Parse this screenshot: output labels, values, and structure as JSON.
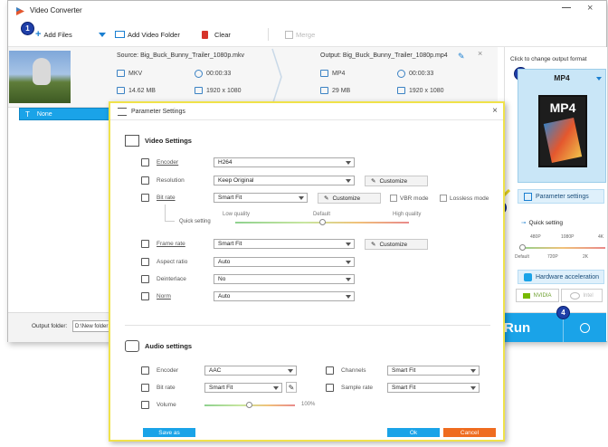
{
  "app": {
    "title": "Video Converter"
  },
  "toolbar": {
    "add_files": "Add Files",
    "add_video_folder": "Add Video Folder",
    "clear": "Clear",
    "merge": "Merge"
  },
  "callouts": [
    "1",
    "2",
    "3",
    "4"
  ],
  "file": {
    "source": "Source: Big_Buck_Bunny_Trailer_1080p.mkv",
    "output": "Output: Big_Buck_Bunny_Trailer_1080p.mp4",
    "src_format": "MKV",
    "src_duration": "00:00:33",
    "src_size": "14.62 MB",
    "src_resolution": "1920 x 1080",
    "out_format": "MP4",
    "out_duration": "00:00:33",
    "out_size": "29 MB",
    "out_resolution": "1920 x 1080",
    "subtitle_value": "None"
  },
  "right_panel": {
    "hint": "Click to change output format",
    "format": "MP4",
    "format_tile_text": "MP4",
    "parameter_settings": "Parameter settings",
    "quick_setting": "Quick setting",
    "ticks_top": [
      "480P",
      "1080P",
      "4K"
    ],
    "ticks_bottom": [
      "Default",
      "720P",
      "2K"
    ],
    "hardware_acceleration": "Hardware acceleration",
    "nvidia": "NVIDIA",
    "intel": "Intel"
  },
  "bottom": {
    "output_folder_label": "Output folder:",
    "output_folder_value": "D:\\New folder",
    "run": "Run"
  },
  "dialog": {
    "title": "Parameter Settings",
    "video_settings": "Video Settings",
    "audio_settings": "Audio settings",
    "video": {
      "encoder_label": "Encoder",
      "encoder_value": "H264",
      "resolution_label": "Resolution",
      "resolution_value": "Keep Original",
      "bitrate_label": "Bit rate",
      "bitrate_value": "Smart Fit",
      "vbr_mode": "VBR mode",
      "lossless_mode": "Lossless mode",
      "low_quality": "Low quality",
      "default": "Default",
      "high_quality": "High quality",
      "quick_setting": "Quick setting",
      "quality_level": 0.5,
      "framerate_label": "Frame rate",
      "framerate_value": "Smart Fit",
      "aspect_label": "Aspect ratio",
      "aspect_value": "Auto",
      "deinterlace_label": "Deinterlace",
      "deinterlace_value": "No",
      "norm_label": "Norm",
      "norm_value": "Auto",
      "customize": "Customize"
    },
    "audio": {
      "encoder_label": "Encoder",
      "encoder_value": "AAC",
      "channels_label": "Channels",
      "channels_value": "Smart Fit",
      "bitrate_label": "Bit rate",
      "bitrate_value": "Smart Fit",
      "samplerate_label": "Sample rate",
      "samplerate_value": "Smart Fit",
      "volume_label": "Volume",
      "volume_value": "100%",
      "volume_level": 1.0
    },
    "save_as": "Save as",
    "ok": "Ok",
    "cancel": "Cancel"
  }
}
